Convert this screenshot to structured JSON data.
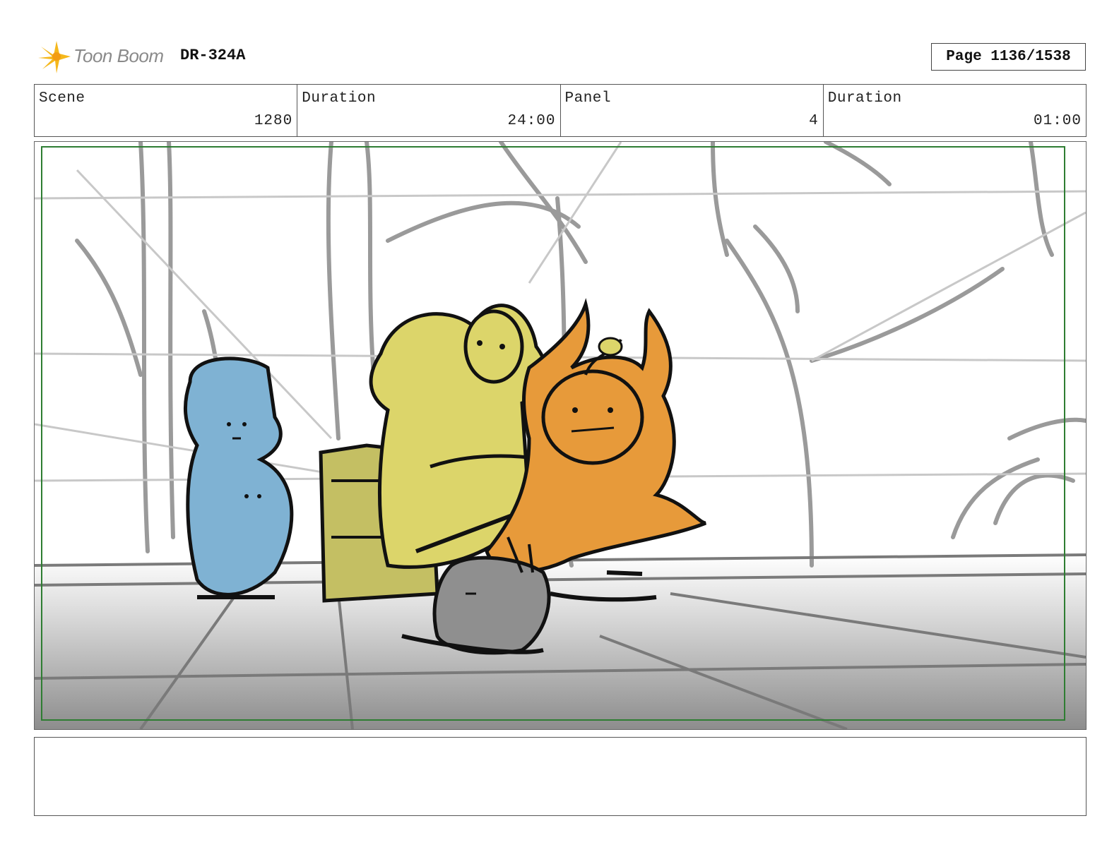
{
  "header": {
    "brand": "Toon Boom",
    "doc_code": "DR-324A",
    "page": "Page 1136/1538"
  },
  "info": [
    {
      "label": "Scene",
      "value": "1280"
    },
    {
      "label": "Duration",
      "value": "24:00"
    },
    {
      "label": "Panel",
      "value": "4"
    },
    {
      "label": "Duration",
      "value": "01:00"
    }
  ],
  "colors": {
    "safe_frame": "#2e7d32",
    "blue_character": "#7fb2d3",
    "yellow_character": "#dcd56a",
    "orange_character": "#e79a3a",
    "gray_character": "#8f8f8f",
    "chest": "#c4bf63",
    "logo_accent": "#f5b81c"
  },
  "notes": ""
}
